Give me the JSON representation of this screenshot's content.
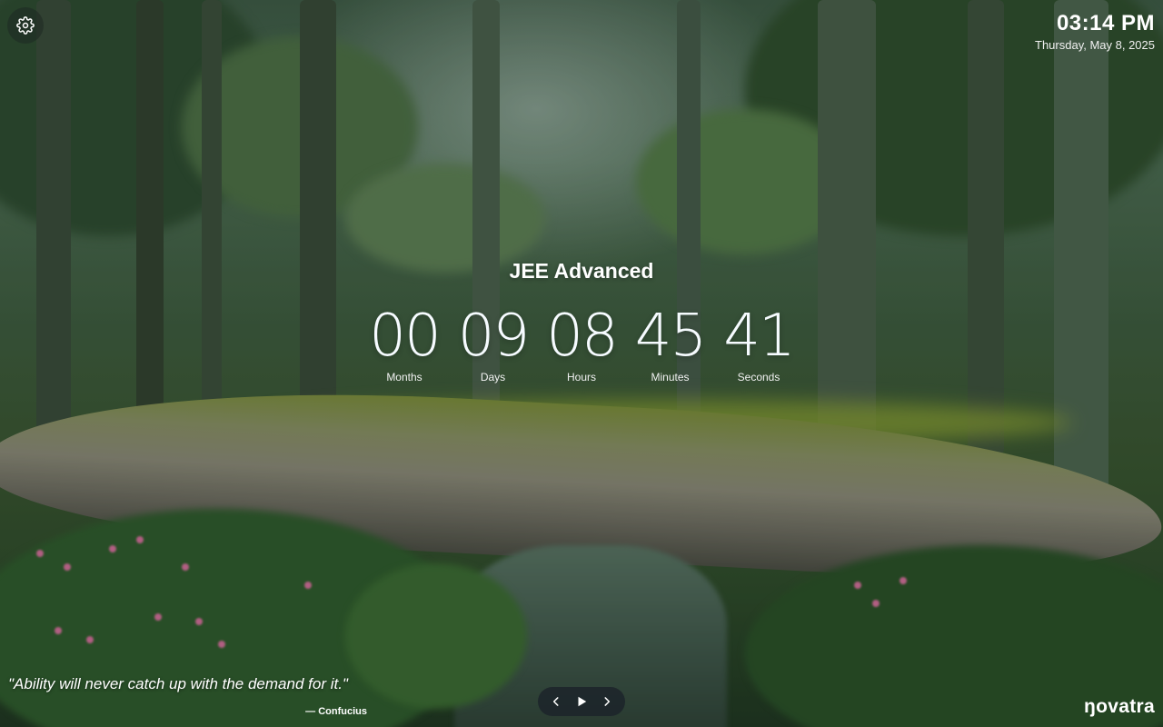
{
  "settings": {
    "icon": "gear-icon"
  },
  "clock": {
    "time": "03:14 PM",
    "date": "Thursday, May 8, 2025"
  },
  "countdown": {
    "title": "JEE Advanced",
    "units": [
      {
        "value": "00",
        "label": "Months"
      },
      {
        "value": "09",
        "label": "Days"
      },
      {
        "value": "08",
        "label": "Hours"
      },
      {
        "value": "45",
        "label": "Minutes"
      },
      {
        "value": "41",
        "label": "Seconds"
      }
    ]
  },
  "quote": {
    "text": "\"Ability will never catch up with the demand for it.\"",
    "author": "— Confucius"
  },
  "player": {
    "prev_icon": "chevron-left-icon",
    "play_icon": "play-icon",
    "next_icon": "chevron-right-icon"
  },
  "brand": {
    "name": "ŋovatra"
  }
}
